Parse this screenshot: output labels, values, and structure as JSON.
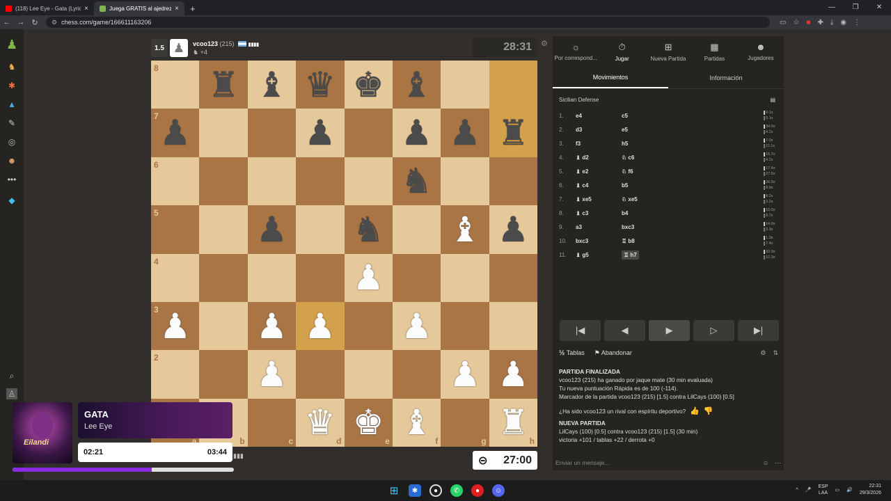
{
  "browser": {
    "tabs": [
      {
        "title": "(118) Lee Eye - Gata (Lyric Vide",
        "active": false,
        "icon": "youtube-icon",
        "color": "#ff0000"
      },
      {
        "title": "Juega GRATIS al ajedrez o",
        "active": true,
        "icon": "chess-pawn-icon",
        "color": "#81b64c"
      }
    ],
    "url": "chess.com/game/166611163206"
  },
  "top_player": {
    "score": "1.5",
    "name": "vcoo123",
    "rating": "(215)",
    "bars": "▮▮▮▮",
    "captured": "+4",
    "clock": "28:31"
  },
  "bottom_player": {
    "clock": "27:00"
  },
  "board": {
    "files": [
      "a",
      "b",
      "c",
      "d",
      "e",
      "f",
      "g",
      "h"
    ],
    "ranks": [
      "8",
      "7",
      "6",
      "5",
      "4",
      "3",
      "2",
      "1"
    ],
    "highlight": [
      "h8",
      "h7",
      "d3"
    ],
    "position": [
      [
        "",
        "bR",
        "bB",
        "bQ",
        "bK",
        "bB",
        "",
        ""
      ],
      [
        "bP",
        "",
        "",
        "bP",
        "",
        "bP",
        "bP",
        "bR"
      ],
      [
        "",
        "",
        "",
        "",
        "",
        "bN",
        "",
        ""
      ],
      [
        "",
        "",
        "bP",
        "",
        "bN",
        "",
        "wB",
        "bP"
      ],
      [
        "",
        "",
        "",
        "",
        "wP",
        "",
        "",
        ""
      ],
      [
        "wP",
        "",
        "wP",
        "wP",
        "",
        "wP",
        "",
        ""
      ],
      [
        "",
        "",
        "wP",
        "",
        "",
        "",
        "wP",
        "wP"
      ],
      [
        "",
        "",
        "",
        "wQ",
        "wK",
        "wB",
        "",
        "wR"
      ]
    ]
  },
  "panel": {
    "top_tabs": [
      {
        "label": "Por correspond...",
        "icon": "sun-icon"
      },
      {
        "label": "Jugar",
        "icon": "stopwatch-icon",
        "active": true
      },
      {
        "label": "Nueva Partida",
        "icon": "plus-icon"
      },
      {
        "label": "Partidas",
        "icon": "board-icon"
      },
      {
        "label": "Jugadores",
        "icon": "users-icon"
      }
    ],
    "sub_tabs": [
      "Movimientos",
      "Información"
    ],
    "opening": "Sicilian Defense",
    "moves": [
      {
        "n": "1.",
        "w": "e4",
        "b": "c5",
        "tw": "0.1s",
        "tb": "0.1s"
      },
      {
        "n": "2.",
        "w": "d3",
        "b": "e5",
        "tw": "34.0s",
        "tb": "4.2s"
      },
      {
        "n": "3.",
        "w": "f3",
        "b": "h5",
        "tw": "7.0s",
        "tb": "11.1s"
      },
      {
        "n": "4.",
        "w": "♝ d2",
        "b": "♘ c6",
        "tw": "15.7s",
        "tb": "4.2s"
      },
      {
        "n": "5.",
        "w": "♝ e2",
        "b": "♘ f6",
        "tw": "17.4s",
        "tb": "27.5s"
      },
      {
        "n": "6.",
        "w": "♝ c4",
        "b": "b5",
        "tw": "26.9s",
        "tb": "8.9s"
      },
      {
        "n": "7.",
        "w": "♝ xe5",
        "b": "♘ xe5",
        "tw": "8.2s",
        "tb": "2.2s"
      },
      {
        "n": "8.",
        "w": "♝ c3",
        "b": "b4",
        "tw": "10.0s",
        "tb": "8.7s"
      },
      {
        "n": "9.",
        "w": "a3",
        "b": "bxc3",
        "tw": "14.9s",
        "tb": "2.3s"
      },
      {
        "n": "10.",
        "w": "bxc3",
        "b": "♖ b8",
        "tw": "1.3s",
        "tb": "7.4s"
      },
      {
        "n": "11.",
        "w": "♝ g5",
        "b": "♖ h7",
        "tw": "33.9s",
        "tb": "12.3s"
      }
    ],
    "draw_label": "Tablas",
    "resign_label": "Abandonar",
    "result_title": "PARTIDA FINALIZADA",
    "result_line1": "vcoo123 (215) ha ganado por jaque mate (30 min evaluada)",
    "result_line2": "Tu nueva puntuación Rápida es de 100 (-114).",
    "result_line3": "Marcador de la partida vcoo123 (215) [1.5] contra LilCays (100) [0.5]",
    "sportsmanship": "¿Ha sido vcoo123 un rival con espíritu deportivo?",
    "new_game_title": "NUEVA PARTIDA",
    "new_game_line1": "LilCays (100) [0.5] contra vcoo123 (215) [1.5] (30 min)",
    "new_game_line2": "victoria +101 / tablas +22 / derrota +0",
    "chat_placeholder": "Enviar un mensaje..."
  },
  "media": {
    "song": "GATA",
    "artist": "Lee Eye",
    "elapsed": "02:21",
    "total": "03:44",
    "progress": 0.63
  },
  "taskbar": {
    "lang": "ESP",
    "layout": "LAA",
    "time": "22:31",
    "date": "29/3/2026"
  }
}
